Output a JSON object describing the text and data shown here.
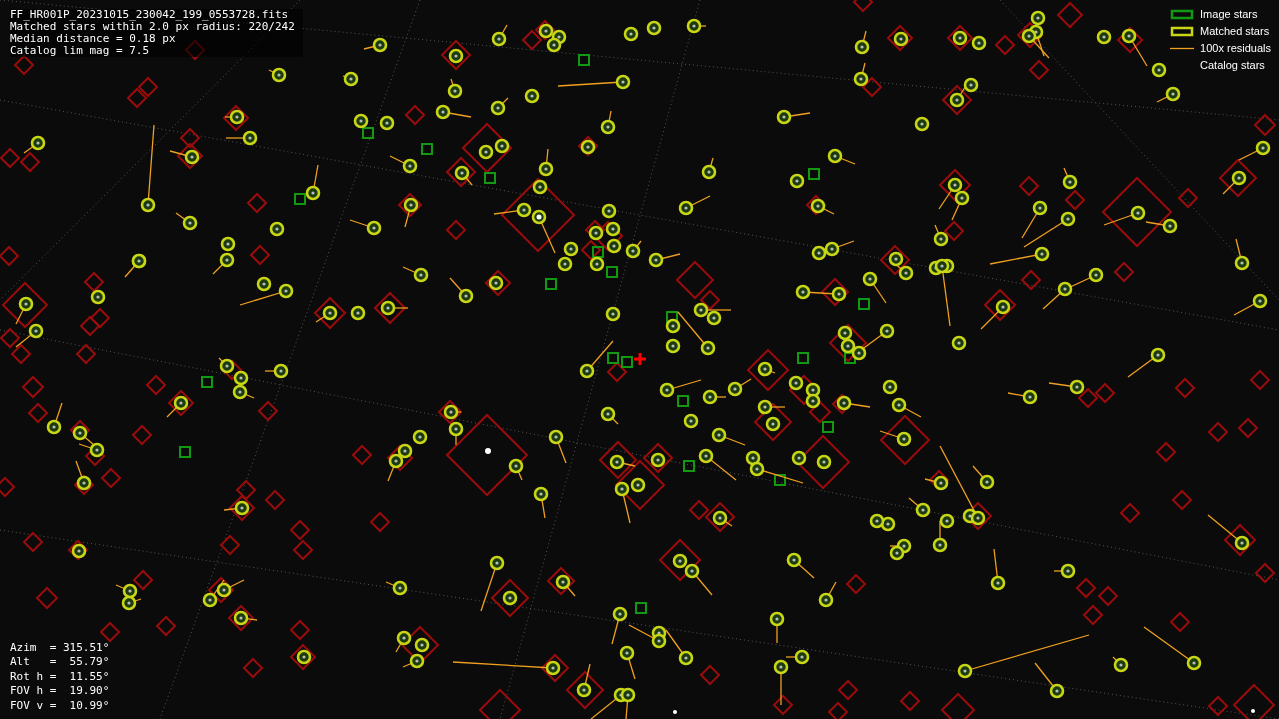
{
  "header": {
    "lines": [
      "FF_HR001P_20231015_230042_199_0553728.fits",
      "Matched stars within 2.0 px radius: 220/242",
      "Median distance = 0.18 px",
      "Catalog lim mag = 7.5"
    ]
  },
  "legend": [
    {
      "kind": "image",
      "label": "Image stars"
    },
    {
      "kind": "matched",
      "label": "Matched stars"
    },
    {
      "kind": "residual",
      "label": "100x residuals"
    },
    {
      "kind": "catalog",
      "label": "Catalog stars"
    }
  ],
  "pointing": {
    "lines": [
      "Azim  = 315.51°",
      "Alt   =  55.79°",
      "Rot h =  11.55°",
      "FOV h =  19.90°",
      "FOV v =  10.99°"
    ]
  }
}
